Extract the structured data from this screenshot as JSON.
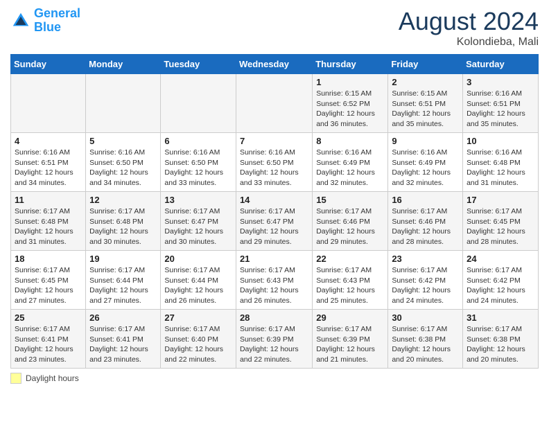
{
  "header": {
    "logo_line1": "General",
    "logo_line2": "Blue",
    "month_year": "August 2024",
    "location": "Kolondieba, Mali"
  },
  "legend": {
    "label": "Daylight hours"
  },
  "days_of_week": [
    "Sunday",
    "Monday",
    "Tuesday",
    "Wednesday",
    "Thursday",
    "Friday",
    "Saturday"
  ],
  "weeks": [
    [
      {
        "day": "",
        "info": ""
      },
      {
        "day": "",
        "info": ""
      },
      {
        "day": "",
        "info": ""
      },
      {
        "day": "",
        "info": ""
      },
      {
        "day": "1",
        "info": "Sunrise: 6:15 AM\nSunset: 6:52 PM\nDaylight: 12 hours\nand 36 minutes."
      },
      {
        "day": "2",
        "info": "Sunrise: 6:15 AM\nSunset: 6:51 PM\nDaylight: 12 hours\nand 35 minutes."
      },
      {
        "day": "3",
        "info": "Sunrise: 6:16 AM\nSunset: 6:51 PM\nDaylight: 12 hours\nand 35 minutes."
      }
    ],
    [
      {
        "day": "4",
        "info": "Sunrise: 6:16 AM\nSunset: 6:51 PM\nDaylight: 12 hours\nand 34 minutes."
      },
      {
        "day": "5",
        "info": "Sunrise: 6:16 AM\nSunset: 6:50 PM\nDaylight: 12 hours\nand 34 minutes."
      },
      {
        "day": "6",
        "info": "Sunrise: 6:16 AM\nSunset: 6:50 PM\nDaylight: 12 hours\nand 33 minutes."
      },
      {
        "day": "7",
        "info": "Sunrise: 6:16 AM\nSunset: 6:50 PM\nDaylight: 12 hours\nand 33 minutes."
      },
      {
        "day": "8",
        "info": "Sunrise: 6:16 AM\nSunset: 6:49 PM\nDaylight: 12 hours\nand 32 minutes."
      },
      {
        "day": "9",
        "info": "Sunrise: 6:16 AM\nSunset: 6:49 PM\nDaylight: 12 hours\nand 32 minutes."
      },
      {
        "day": "10",
        "info": "Sunrise: 6:16 AM\nSunset: 6:48 PM\nDaylight: 12 hours\nand 31 minutes."
      }
    ],
    [
      {
        "day": "11",
        "info": "Sunrise: 6:17 AM\nSunset: 6:48 PM\nDaylight: 12 hours\nand 31 minutes."
      },
      {
        "day": "12",
        "info": "Sunrise: 6:17 AM\nSunset: 6:48 PM\nDaylight: 12 hours\nand 30 minutes."
      },
      {
        "day": "13",
        "info": "Sunrise: 6:17 AM\nSunset: 6:47 PM\nDaylight: 12 hours\nand 30 minutes."
      },
      {
        "day": "14",
        "info": "Sunrise: 6:17 AM\nSunset: 6:47 PM\nDaylight: 12 hours\nand 29 minutes."
      },
      {
        "day": "15",
        "info": "Sunrise: 6:17 AM\nSunset: 6:46 PM\nDaylight: 12 hours\nand 29 minutes."
      },
      {
        "day": "16",
        "info": "Sunrise: 6:17 AM\nSunset: 6:46 PM\nDaylight: 12 hours\nand 28 minutes."
      },
      {
        "day": "17",
        "info": "Sunrise: 6:17 AM\nSunset: 6:45 PM\nDaylight: 12 hours\nand 28 minutes."
      }
    ],
    [
      {
        "day": "18",
        "info": "Sunrise: 6:17 AM\nSunset: 6:45 PM\nDaylight: 12 hours\nand 27 minutes."
      },
      {
        "day": "19",
        "info": "Sunrise: 6:17 AM\nSunset: 6:44 PM\nDaylight: 12 hours\nand 27 minutes."
      },
      {
        "day": "20",
        "info": "Sunrise: 6:17 AM\nSunset: 6:44 PM\nDaylight: 12 hours\nand 26 minutes."
      },
      {
        "day": "21",
        "info": "Sunrise: 6:17 AM\nSunset: 6:43 PM\nDaylight: 12 hours\nand 26 minutes."
      },
      {
        "day": "22",
        "info": "Sunrise: 6:17 AM\nSunset: 6:43 PM\nDaylight: 12 hours\nand 25 minutes."
      },
      {
        "day": "23",
        "info": "Sunrise: 6:17 AM\nSunset: 6:42 PM\nDaylight: 12 hours\nand 24 minutes."
      },
      {
        "day": "24",
        "info": "Sunrise: 6:17 AM\nSunset: 6:42 PM\nDaylight: 12 hours\nand 24 minutes."
      }
    ],
    [
      {
        "day": "25",
        "info": "Sunrise: 6:17 AM\nSunset: 6:41 PM\nDaylight: 12 hours\nand 23 minutes."
      },
      {
        "day": "26",
        "info": "Sunrise: 6:17 AM\nSunset: 6:41 PM\nDaylight: 12 hours\nand 23 minutes."
      },
      {
        "day": "27",
        "info": "Sunrise: 6:17 AM\nSunset: 6:40 PM\nDaylight: 12 hours\nand 22 minutes."
      },
      {
        "day": "28",
        "info": "Sunrise: 6:17 AM\nSunset: 6:39 PM\nDaylight: 12 hours\nand 22 minutes."
      },
      {
        "day": "29",
        "info": "Sunrise: 6:17 AM\nSunset: 6:39 PM\nDaylight: 12 hours\nand 21 minutes."
      },
      {
        "day": "30",
        "info": "Sunrise: 6:17 AM\nSunset: 6:38 PM\nDaylight: 12 hours\nand 20 minutes."
      },
      {
        "day": "31",
        "info": "Sunrise: 6:17 AM\nSunset: 6:38 PM\nDaylight: 12 hours\nand 20 minutes."
      }
    ]
  ]
}
